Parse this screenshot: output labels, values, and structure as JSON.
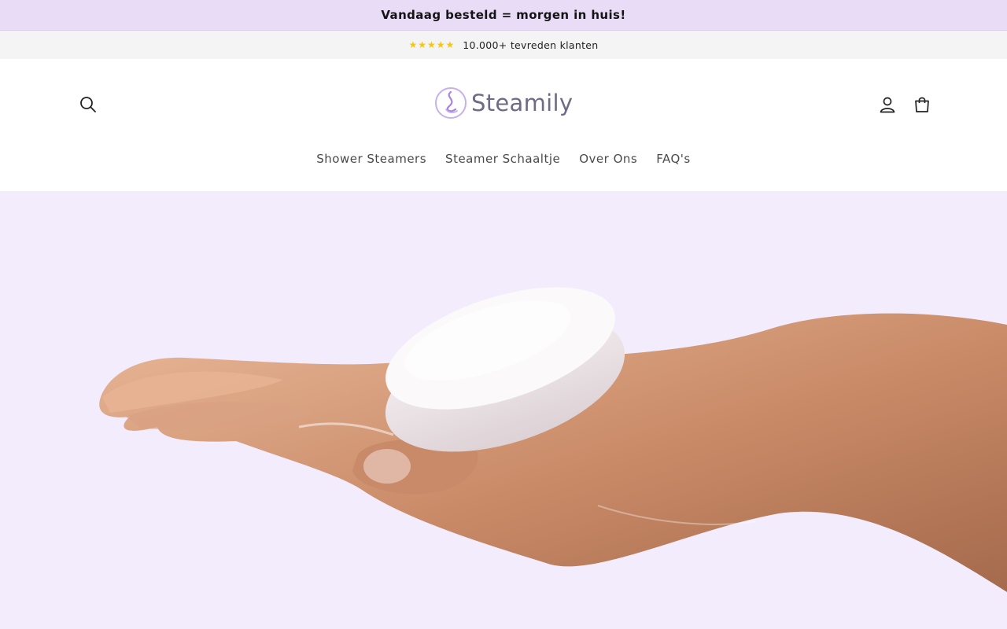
{
  "announcement": {
    "text": "Vandaag besteld = morgen in huis!"
  },
  "rating": {
    "stars": "★★★★★",
    "text": "10.000+ tevreden klanten"
  },
  "header": {
    "logo_text": "Steamily",
    "icons": {
      "search": "search-icon",
      "account": "user-icon",
      "cart": "shopping-bag-icon"
    }
  },
  "nav": {
    "items": [
      {
        "label": "Shower Steamers"
      },
      {
        "label": "Steamer Schaaltje"
      },
      {
        "label": "Over Ons"
      },
      {
        "label": "FAQ's"
      }
    ]
  },
  "hero": {
    "image": "hand-holding-shower-steamer-tablet"
  },
  "colors": {
    "announcement_bg": "#e8dcf6",
    "hero_bg": "#f2ecfd",
    "star": "#f5c518",
    "logo_accent": "#b79be0"
  }
}
